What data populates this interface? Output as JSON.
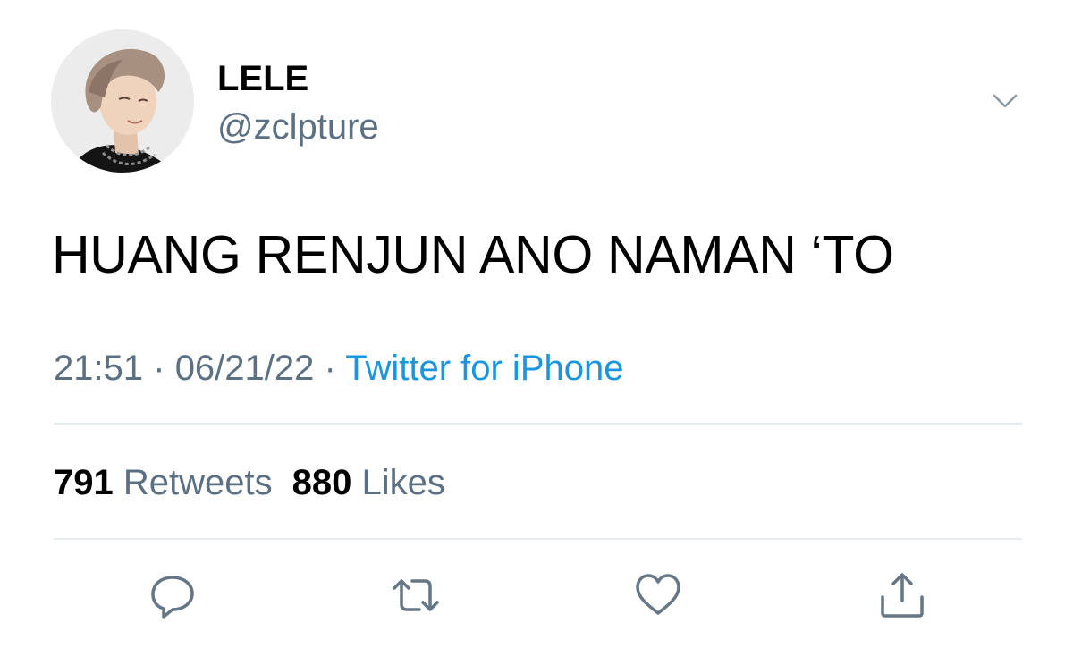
{
  "author": {
    "display_name": "LELE",
    "handle": "@zclpture",
    "avatar_icon": "profile-photo-avatar"
  },
  "tweet": {
    "text": "HUANG RENJUN ANO NAMAN ‘TO",
    "time": "21:51",
    "separator": "·",
    "date": "06/21/22",
    "source": "Twitter for iPhone"
  },
  "stats": {
    "retweets_count": "791",
    "retweets_label": "Retweets",
    "likes_count": "880",
    "likes_label": "Likes"
  },
  "actions": {
    "reply_icon": "speech-bubble-icon",
    "retweet_icon": "retweet-arrows-icon",
    "like_icon": "heart-icon",
    "share_icon": "share-upload-icon"
  },
  "colors": {
    "text": "#000000",
    "secondary": "#5b7083",
    "link": "#1b95e0",
    "divider": "#e6ecf0",
    "icon": "#657786"
  }
}
